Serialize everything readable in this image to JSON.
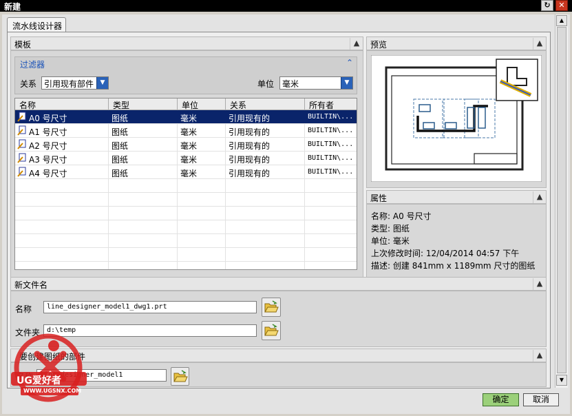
{
  "window": {
    "title": "新建",
    "help_glyph": "↻",
    "close_glyph": "✕"
  },
  "tab": {
    "label": "流水线设计器"
  },
  "template": {
    "header": "模板",
    "filter": {
      "header": "过滤器",
      "relation_label": "关系",
      "relation_value": "引用现有部件",
      "unit_label": "单位",
      "unit_value": "毫米"
    },
    "columns": [
      "名称",
      "类型",
      "单位",
      "关系",
      "所有者"
    ],
    "rows": [
      {
        "name": "A0 号尺寸",
        "type": "图纸",
        "unit": "毫米",
        "relation": "引用现有的",
        "owner": "BUILTIN\\..."
      },
      {
        "name": "A1 号尺寸",
        "type": "图纸",
        "unit": "毫米",
        "relation": "引用现有的",
        "owner": "BUILTIN\\..."
      },
      {
        "name": "A2 号尺寸",
        "type": "图纸",
        "unit": "毫米",
        "relation": "引用现有的",
        "owner": "BUILTIN\\..."
      },
      {
        "name": "A3 号尺寸",
        "type": "图纸",
        "unit": "毫米",
        "relation": "引用现有的",
        "owner": "BUILTIN\\..."
      },
      {
        "name": "A4 号尺寸",
        "type": "图纸",
        "unit": "毫米",
        "relation": "引用现有的",
        "owner": "BUILTIN\\..."
      }
    ],
    "selected_row": 0
  },
  "preview": {
    "header": "预览"
  },
  "properties": {
    "header": "属性",
    "items": [
      {
        "label": "名称:",
        "value": "A0 号尺寸"
      },
      {
        "label": "类型:",
        "value": "图纸"
      },
      {
        "label": "单位:",
        "value": "毫米"
      },
      {
        "label": "上次修改时间:",
        "value": "12/04/2014 04:57 下午"
      },
      {
        "label": "描述:",
        "value": "创建 841mm x 1189mm 尺寸的图纸"
      }
    ]
  },
  "new_file": {
    "header": "新文件名",
    "name_label": "名称",
    "name_value": "line_designer_model1_dwg1.prt",
    "folder_label": "文件夹",
    "folder_value": "d:\\temp"
  },
  "ref_part": {
    "header": "要创建图纸的部件",
    "name_label": "名称",
    "name_value": "line_designer_model1"
  },
  "buttons": {
    "ok": "确定",
    "cancel": "取消"
  },
  "watermark": {
    "logo": "UG爱好者",
    "url": "WWW.UGSNX.COM"
  }
}
